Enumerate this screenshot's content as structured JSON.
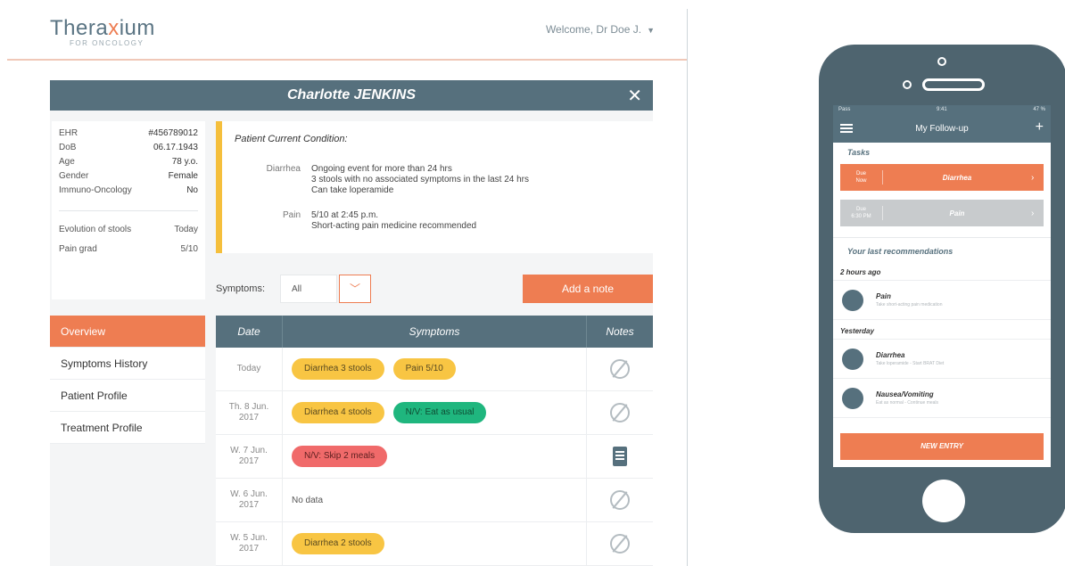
{
  "desktop": {
    "logo": {
      "main": "Thera",
      "accent": "x",
      "rest": "ium",
      "sub": "FOR ONCOLOGY"
    },
    "welcome": "Welcome, Dr Doe J.",
    "patient_name": "Charlotte JENKINS",
    "info": [
      {
        "label": "EHR",
        "value": "#456789012"
      },
      {
        "label": "DoB",
        "value": "06.17.1943"
      },
      {
        "label": "Age",
        "value": "78 y.o."
      },
      {
        "label": "Gender",
        "value": "Female"
      },
      {
        "label": "Immuno-Oncology",
        "value": "No"
      }
    ],
    "info2": [
      {
        "label": "Evolution of stools",
        "value": "Today"
      },
      {
        "label": "Pain grad",
        "value": "5/10"
      }
    ],
    "nav": [
      "Overview",
      "Symptoms History",
      "Patient Profile",
      "Treatment Profile"
    ],
    "condition": {
      "title": "Patient Current Condition:",
      "items": [
        {
          "label": "Diarrhea",
          "lines": [
            "Ongoing event for more than 24 hrs",
            "3 stools with no associated symptoms in the last 24 hrs",
            "Can take loperamide"
          ]
        },
        {
          "label": "Pain",
          "lines": [
            "5/10 at 2:45 p.m.",
            "Short-acting pain medicine recommended"
          ]
        }
      ]
    },
    "symptoms_label": "Symptoms:",
    "symptoms_filter": "All",
    "add_note": "Add a note",
    "table": {
      "headers": [
        "Date",
        "Symptoms",
        "Notes"
      ],
      "rows": [
        {
          "date": [
            "Today"
          ],
          "pills": [
            {
              "text": "Diarrhea 3 stools",
              "color": "yellow"
            },
            {
              "text": "Pain 5/10",
              "color": "yellow"
            }
          ],
          "note": "none"
        },
        {
          "date": [
            "Th. 8 Jun.",
            "2017"
          ],
          "pills": [
            {
              "text": "Diarrhea 4 stools",
              "color": "yellow"
            },
            {
              "text": "N/V: Eat as usual",
              "color": "green"
            }
          ],
          "note": "none"
        },
        {
          "date": [
            "W. 7 Jun.",
            "2017"
          ],
          "pills": [
            {
              "text": "N/V: Skip 2 meals",
              "color": "red"
            }
          ],
          "note": "note"
        },
        {
          "date": [
            "W. 6 Jun.",
            "2017"
          ],
          "pills": [],
          "nodata": "No data",
          "note": "none"
        },
        {
          "date": [
            "W. 5 Jun.",
            "2017"
          ],
          "pills": [
            {
              "text": "Diarrhea 2 stools",
              "color": "yellow"
            }
          ],
          "note": "none"
        }
      ]
    }
  },
  "phone": {
    "status_left": "Pass",
    "status_time": "9:41",
    "status_right": "47 %",
    "title": "My Follow-up",
    "tasks_label": "Tasks",
    "tasks": [
      {
        "time": [
          "Due",
          "Now"
        ],
        "name": "Diarrhea",
        "color": "orange"
      },
      {
        "time": [
          "Due",
          "6:30 PM"
        ],
        "name": "Pain",
        "color": "grey"
      }
    ],
    "recs_label": "Your last recommendations",
    "groups": [
      {
        "label": "2 hours ago",
        "items": [
          {
            "title": "Pain",
            "sub": "Take short-acting pain medication"
          }
        ]
      },
      {
        "label": "Yesterday",
        "items": [
          {
            "title": "Diarrhea",
            "sub": "Take loperamide - Start BRAT Diet"
          },
          {
            "title": "Nausea/Vomiting",
            "sub": "Eat as normal - Continue meals"
          }
        ]
      }
    ],
    "new_entry": "NEW ENTRY"
  }
}
